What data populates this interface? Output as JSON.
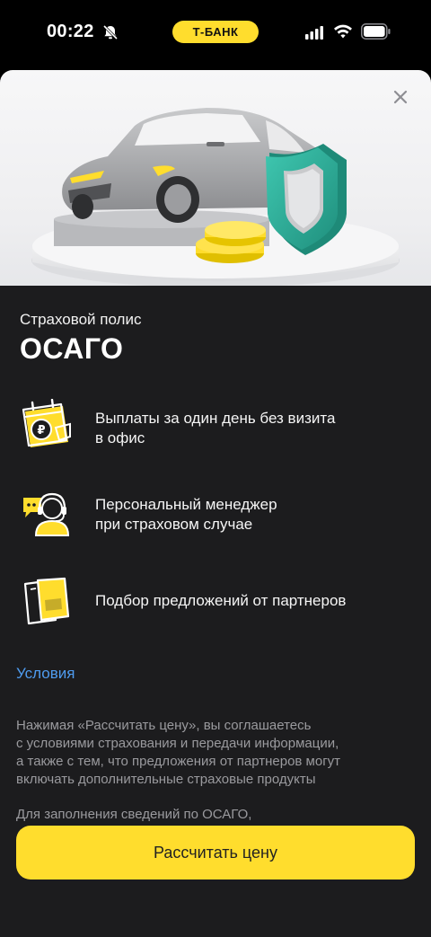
{
  "status_bar": {
    "time": "00:22",
    "bank_label": "Т-БАНК",
    "accent": "#ffdd2d"
  },
  "sheet": {
    "close_icon": "close-icon",
    "subtitle": "Страховой полис",
    "title": "ОСАГО",
    "features": [
      {
        "icon": "calendar-ruble-icon",
        "line1": "Выплаты за один день без визита",
        "line2": "в офис"
      },
      {
        "icon": "manager-headset-icon",
        "line1": "Персональный менеджер",
        "line2": "при страховом случае"
      },
      {
        "icon": "documents-icon",
        "line1": "Подбор предложений  от партнеров",
        "line2": ""
      }
    ],
    "conditions_link": "Условия",
    "legal_lines": [
      "Нажимая «Рассчитать цену», вы соглашаетесь",
      "с условиями страхования и передачи информации,",
      "а также с тем, что предложения от партнеров могут",
      "включать дополнительные страховые продукты"
    ],
    "legal_second": "Для заполнения сведений по ОСАГО,",
    "cta_label": "Рассчитать цену",
    "link_color": "#4f9cf0"
  }
}
